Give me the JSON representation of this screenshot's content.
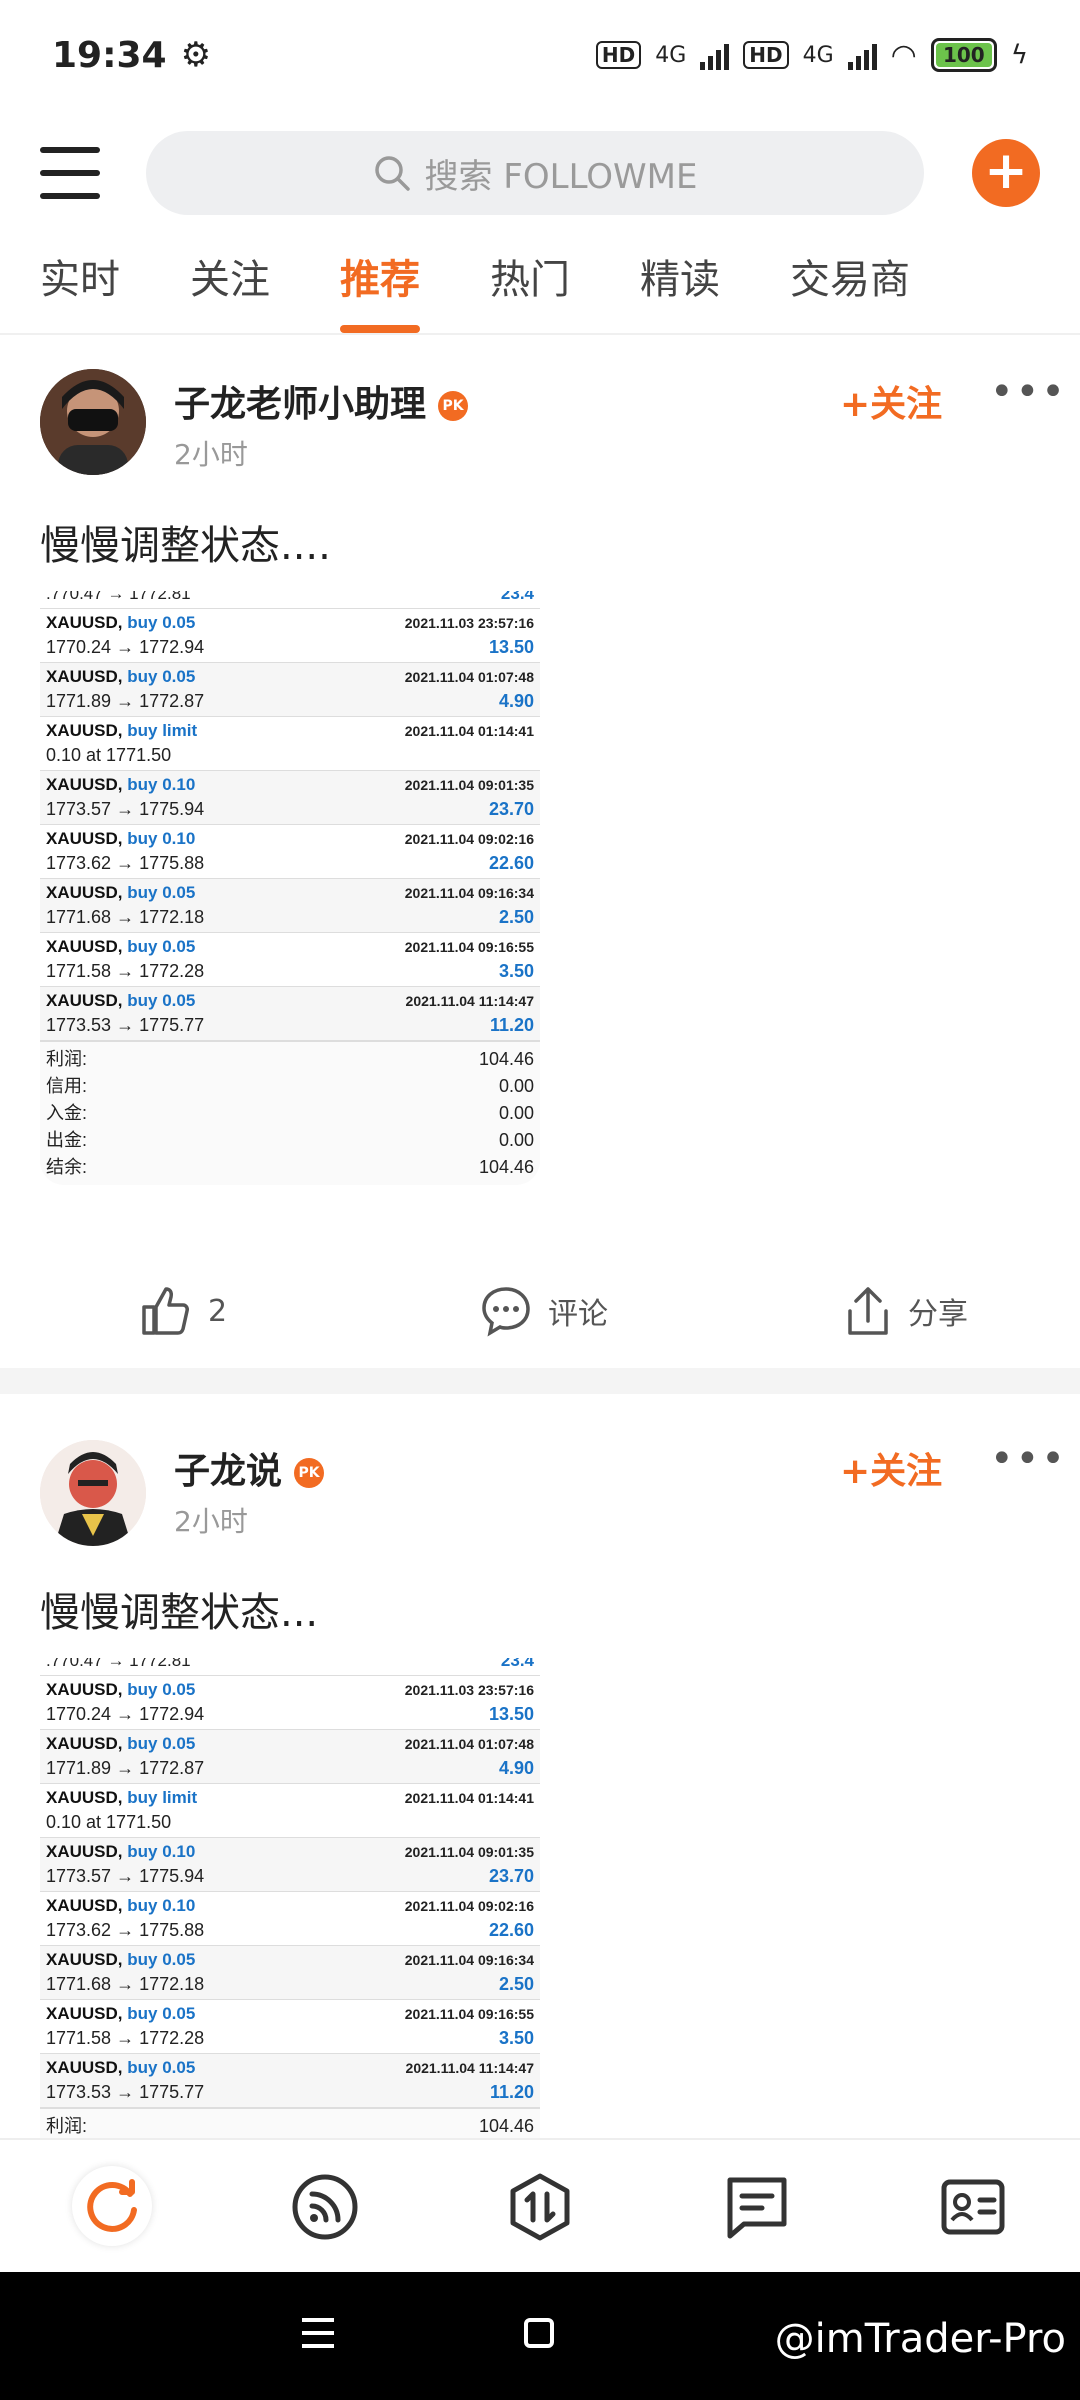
{
  "status": {
    "time": "19:34",
    "battery": "100",
    "network1": "4G",
    "network2": "4G",
    "hd": "HD"
  },
  "header": {
    "search_placeholder": "搜索 FOLLOWME"
  },
  "tabs": [
    "实时",
    "关注",
    "推荐",
    "热门",
    "精读",
    "交易商"
  ],
  "active_tab": "推荐",
  "posts": [
    {
      "user": "子龙老师小助理",
      "badge": "PK",
      "time": "2小时",
      "follow": "+关注",
      "text": "慢慢调整状态....",
      "likes": "2",
      "comment": "评论",
      "share": "分享"
    },
    {
      "user": "子龙说",
      "badge": "PK",
      "time": "2小时",
      "follow": "+关注",
      "text": "慢慢调整状态..."
    }
  ],
  "trades_partial": {
    "left": ".770.47 → 1772.81",
    "right": "23.4"
  },
  "trades": [
    {
      "sym": "XAUUSD,",
      "act": "buy 0.05",
      "dt": "2021.11.03 23:57:16",
      "prices": "1770.24 → 1772.94",
      "pl": "13.50"
    },
    {
      "sym": "XAUUSD,",
      "act": "buy 0.05",
      "dt": "2021.11.04 01:07:48",
      "prices": "1771.89 → 1772.87",
      "pl": "4.90"
    },
    {
      "sym": "XAUUSD,",
      "act": "buy limit",
      "dt": "2021.11.04 01:14:41",
      "prices": "0.10 at 1771.50",
      "pl": ""
    },
    {
      "sym": "XAUUSD,",
      "act": "buy 0.10",
      "dt": "2021.11.04 09:01:35",
      "prices": "1773.57 → 1775.94",
      "pl": "23.70"
    },
    {
      "sym": "XAUUSD,",
      "act": "buy 0.10",
      "dt": "2021.11.04 09:02:16",
      "prices": "1773.62 → 1775.88",
      "pl": "22.60"
    },
    {
      "sym": "XAUUSD,",
      "act": "buy 0.05",
      "dt": "2021.11.04 09:16:34",
      "prices": "1771.68 → 1772.18",
      "pl": "2.50"
    },
    {
      "sym": "XAUUSD,",
      "act": "buy 0.05",
      "dt": "2021.11.04 09:16:55",
      "prices": "1771.58 → 1772.28",
      "pl": "3.50"
    },
    {
      "sym": "XAUUSD,",
      "act": "buy 0.05",
      "dt": "2021.11.04 11:14:47",
      "prices": "1773.53 → 1775.77",
      "pl": "11.20"
    }
  ],
  "summary": [
    {
      "label": "利润:",
      "value": "104.46"
    },
    {
      "label": "信用:",
      "value": "0.00"
    },
    {
      "label": "入金:",
      "value": "0.00"
    },
    {
      "label": "出金:",
      "value": "0.00"
    },
    {
      "label": "结余:",
      "value": "104.46"
    }
  ],
  "watermark": "@imTrader-Pro"
}
